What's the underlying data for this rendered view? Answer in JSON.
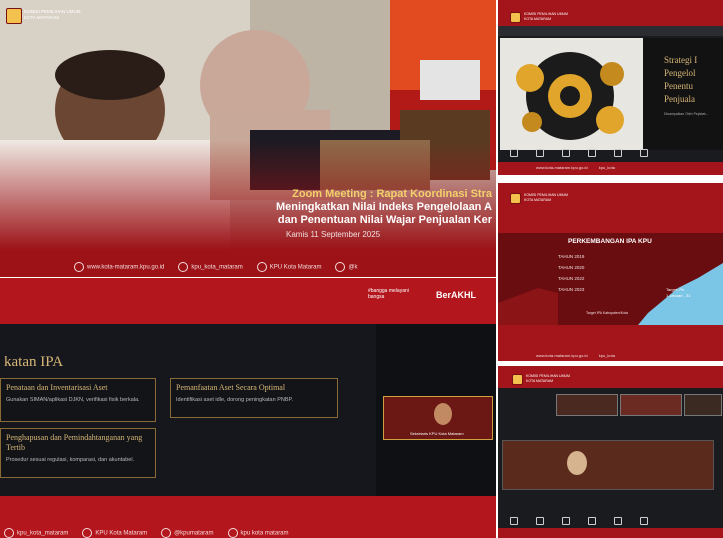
{
  "top_left": {
    "org_line1": "KOMISI PEMILIHAN UMUM",
    "org_line2": "KOTA MATARAM",
    "title_line1": "Zoom Meeting : Rapat Koordinasi Stra",
    "title_line2": "Meningkatkan Nilai Indeks Pengelolaan A",
    "title_line3": "dan Penentuan Nilai Wajar Penjualan Ker",
    "date": "Kamis 11 September 2025",
    "social": [
      "www.kota-mataram.kpu.go.id",
      "kpu_kota_mataram",
      "KPU Kota Mataram",
      "@k"
    ]
  },
  "top_right": {
    "org_line1": "KOMISI PEMILIHAN UMUM",
    "org_line2": "KOTA MATARAM",
    "slide_text": [
      "Strategi I",
      "Pengelol",
      "Penentu",
      "Penjuala"
    ],
    "slide_small": "Disampaikan Oleh Pejabat...",
    "footer": [
      "www.kota-mataram.kpu.go.id",
      "kpu_kota",
      ""
    ]
  },
  "mid_right": {
    "org_line1": "KOMISI PEMILIHAN UMUM",
    "org_line2": "KOTA MATARAM",
    "slide_title": "PERKEMBANGAN IPA KPU",
    "years": [
      "TAHUN 2019",
      "TAHUN 2020",
      "TAHUN 2022",
      "TAHUN 2023"
    ],
    "notes": [
      "Target: Pe",
      "1 Januari - 31",
      "Target IPA Kabupaten/Kota"
    ],
    "footer": [
      "www.kota-mataram.kpu.go.id",
      "kpu_kota"
    ]
  },
  "bottom_right": {
    "org_line1": "KOMISI PEMILIHAN UMUM",
    "org_line2": "KOTA MATARAM"
  },
  "bottom_left": {
    "brand1": "#bangga melayani bangsa",
    "brand2": "BerAKHL",
    "heading": "katan IPA",
    "cards": [
      {
        "title": "Penataan dan Inventarisasi Aset",
        "desc": "Gunakan SIMAN/aplikasi DJKN, verifikasi fisik berkala."
      },
      {
        "title": "Pemanfaatan Aset Secara Optimal",
        "desc": "Identifikasi aset idle, dorong peningkatan PNBP."
      },
      {
        "title": "Penghapusan dan Pemindahtanganan yang Tertib",
        "desc": "Prosedur sesuai regulasi, komparasi, dan akuntabel."
      }
    ],
    "video_name": "Sekretaris KPU Kota Mataram",
    "social": [
      "kpu_kota_mataram",
      "KPU Kota Mataram",
      "@kpumataram",
      "kpu kota mataram"
    ]
  },
  "colors": {
    "red": "#b3161c",
    "dark_red": "#7d0d10",
    "navy": "#1b1d24",
    "gold": "#d8b777"
  }
}
